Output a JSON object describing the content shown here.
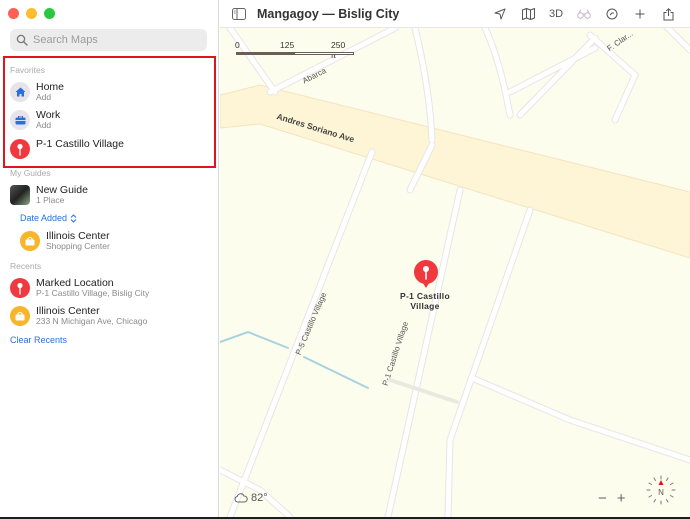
{
  "window": {
    "title": "Mangagoy — Bislig City"
  },
  "toolbar": {
    "tools": [
      {
        "icon": "location-arrow-icon",
        "label": ""
      },
      {
        "icon": "map-icon",
        "label": ""
      },
      {
        "icon": "3d-icon",
        "label": "3D"
      },
      {
        "icon": "binoculars-icon",
        "label": ""
      },
      {
        "icon": "clock-icon",
        "label": ""
      },
      {
        "icon": "plus-icon",
        "label": ""
      },
      {
        "icon": "share-icon",
        "label": ""
      }
    ]
  },
  "sidebar": {
    "search_placeholder": "Search Maps",
    "favorites": {
      "label": "Favorites",
      "items": [
        {
          "title": "Home",
          "subtitle": "Add",
          "icon": "house-icon"
        },
        {
          "title": "Work",
          "subtitle": "Add",
          "icon": "briefcase-icon"
        },
        {
          "title": "P-1 Castillo Village",
          "subtitle": "",
          "icon": "pin-icon"
        }
      ]
    },
    "guides": {
      "label": "My Guides",
      "items": [
        {
          "title": "New Guide",
          "subtitle": "1 Place",
          "icon": "guide-thumbnail"
        }
      ],
      "sort_label": "Date Added",
      "places": [
        {
          "title": "Illinois Center",
          "subtitle": "Shopping Center",
          "icon": "shopping-bag-icon"
        }
      ]
    },
    "recents": {
      "label": "Recents",
      "items": [
        {
          "title": "Marked Location",
          "subtitle": "P-1 Castillo Village, Bislig City",
          "icon": "pin-icon"
        },
        {
          "title": "Illinois Center",
          "subtitle": "233 N Michigan Ave, Chicago",
          "icon": "shopping-bag-icon"
        }
      ],
      "clear_label": "Clear Recents"
    }
  },
  "map": {
    "scale": {
      "labels": [
        "0",
        "125",
        "250 ft"
      ]
    },
    "streets": {
      "abarca": "Abarca",
      "andres": "Andres Soriano Ave",
      "p5": "P-5 Castillo Village",
      "p1": "P-1 Castillo Village",
      "fclar": "F. Clar..."
    },
    "pin_label_line1": "P-1 Castillo",
    "pin_label_line2": "Village",
    "weather": "82°",
    "zoom_out": "−",
    "zoom_in": "+",
    "compass": "N"
  },
  "colors": {
    "accent": "#2a6fe0",
    "pin": "#f0383e",
    "highlight_box": "#e0141e",
    "map_land": "#fdfdee",
    "major_road": "#fdf5d5"
  }
}
